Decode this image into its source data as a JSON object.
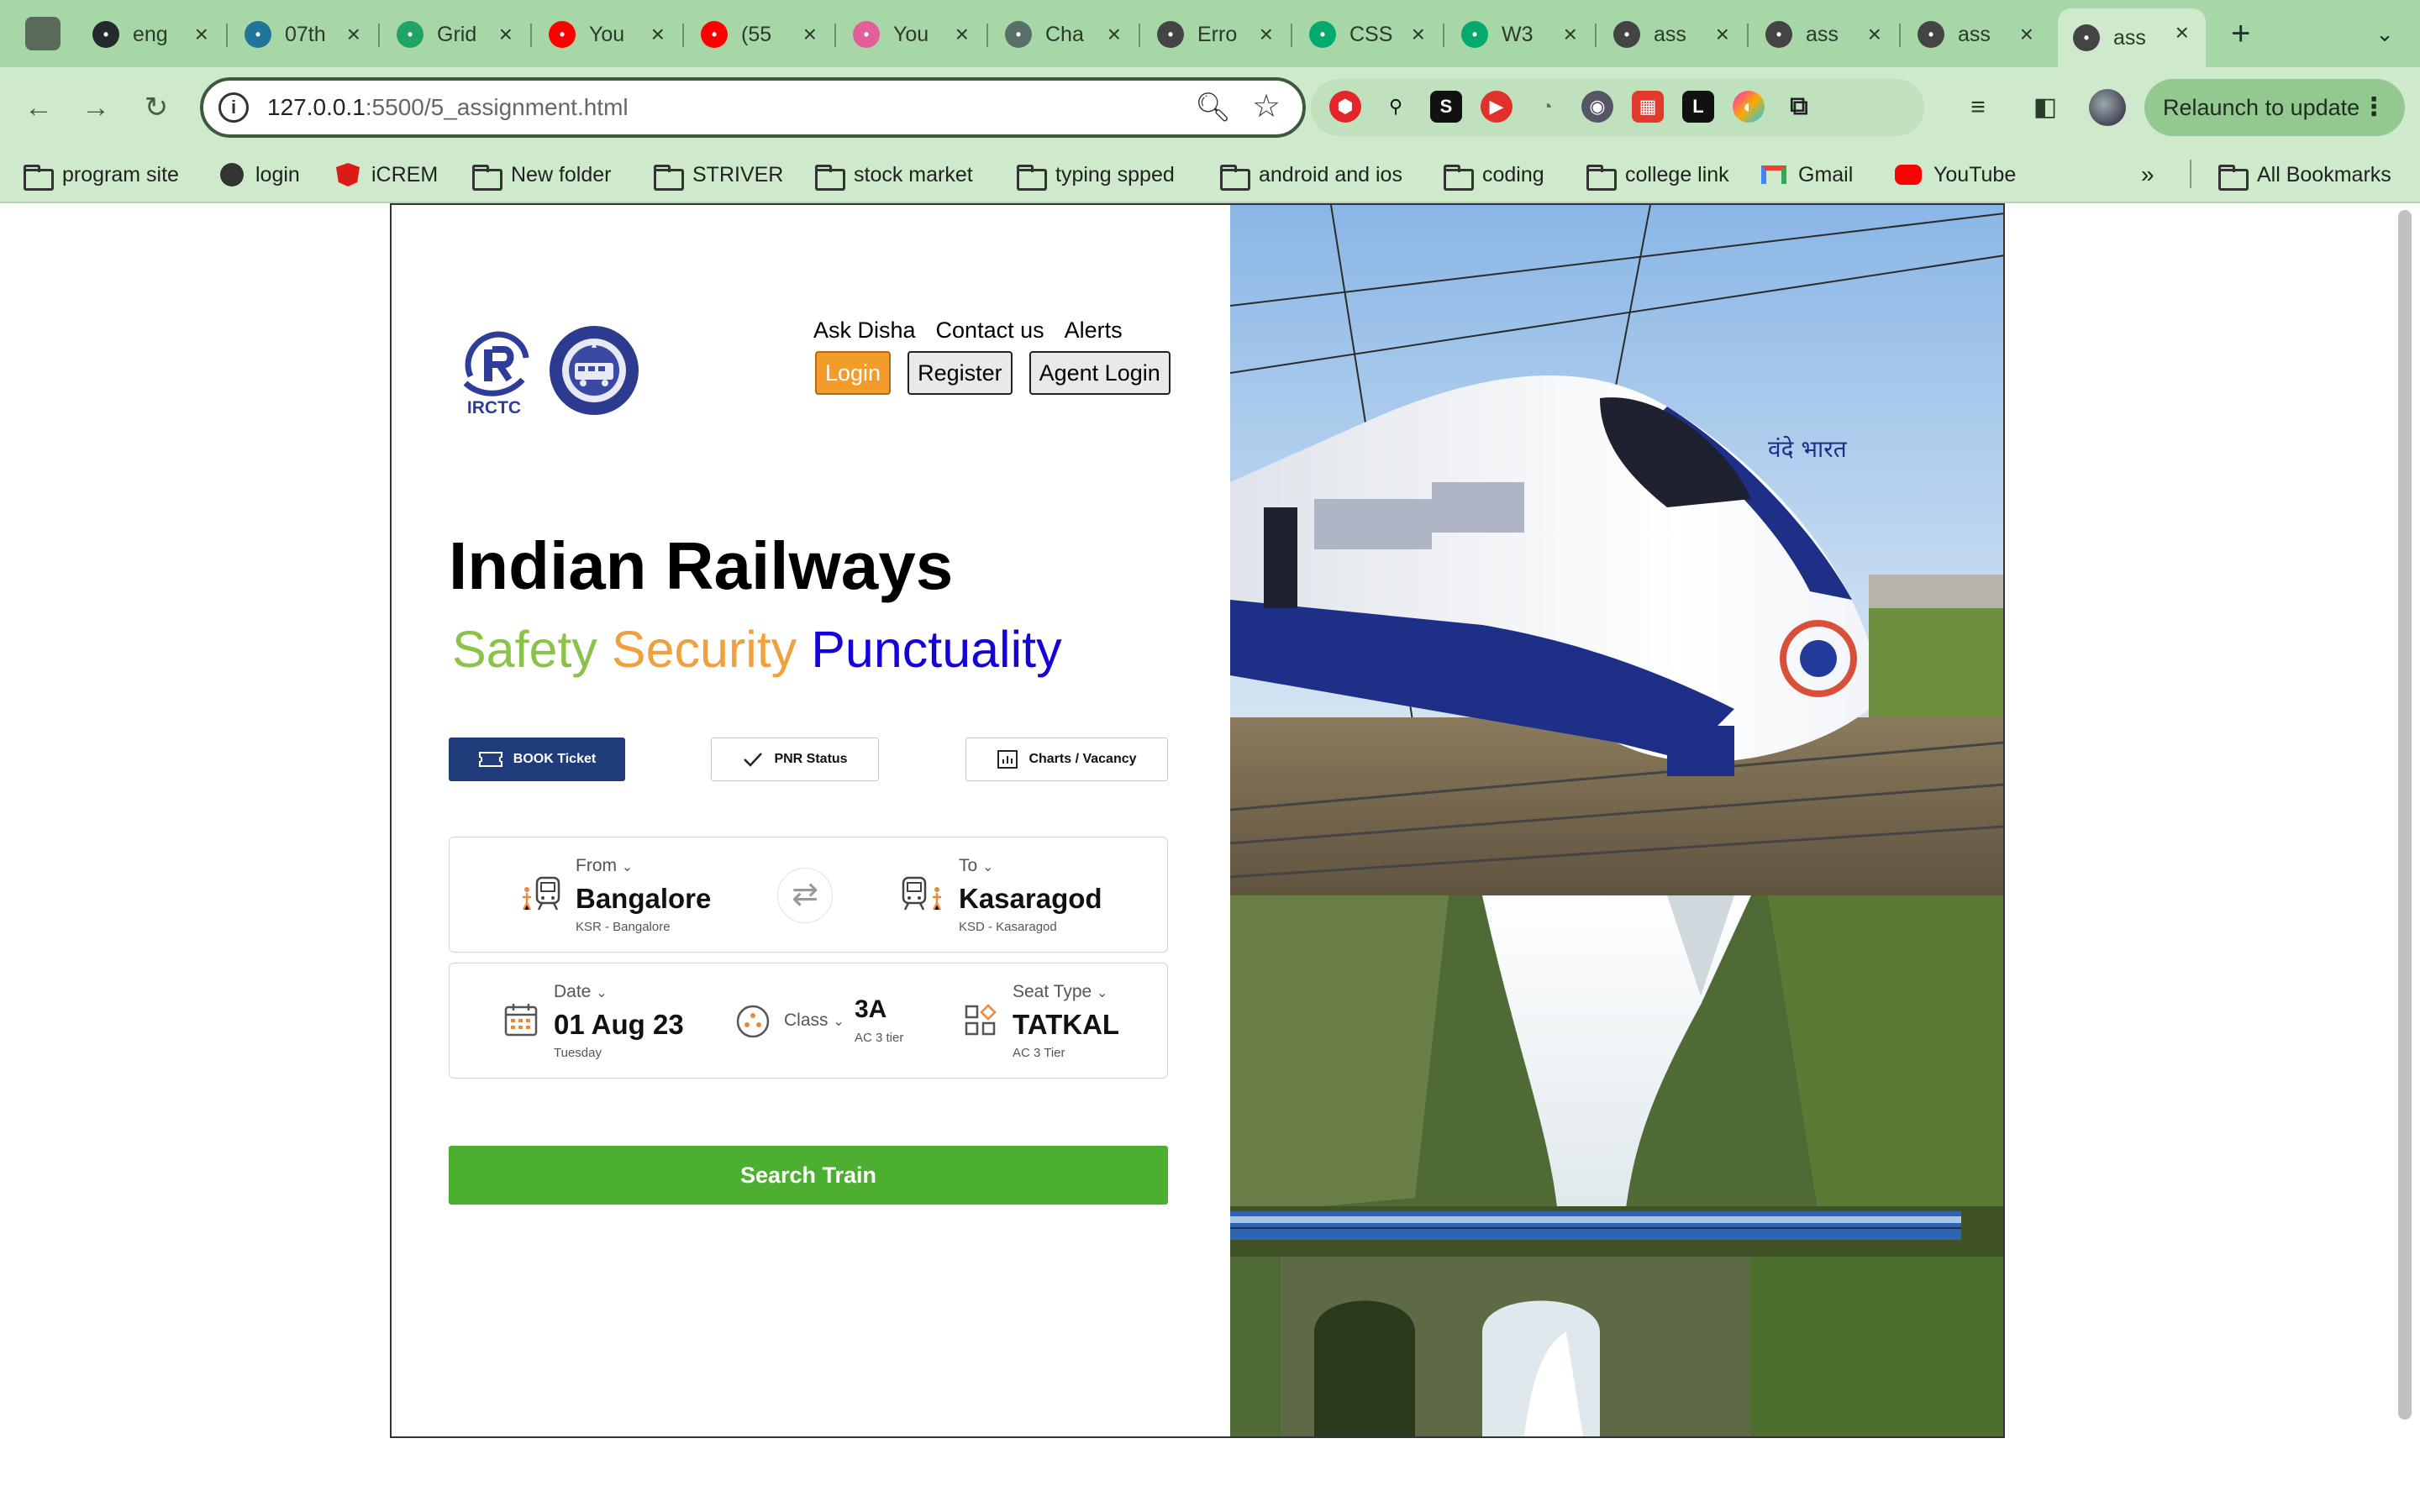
{
  "browser": {
    "tabs": [
      {
        "title": "eng",
        "icon": "github-icon",
        "color": "#24292e"
      },
      {
        "title": "07th",
        "icon": "wordpress-icon",
        "color": "#21759b"
      },
      {
        "title": "Grid",
        "icon": "drive-icon",
        "color": "#1fa463"
      },
      {
        "title": "You",
        "icon": "youtube-music-icon",
        "color": "#ff0000"
      },
      {
        "title": "(55",
        "icon": "youtube-icon",
        "color": "#ff0000"
      },
      {
        "title": "You",
        "icon": "music-note-icon",
        "color": "#e25f9a"
      },
      {
        "title": "Cha",
        "icon": "chatgpt-icon",
        "color": "#5a6e6a"
      },
      {
        "title": "Erro",
        "icon": "globe-icon",
        "color": "#444444"
      },
      {
        "title": "CSS",
        "icon": "w3schools-icon",
        "color": "#04aa6d"
      },
      {
        "title": "W3",
        "icon": "w3schools-icon",
        "color": "#04aa6d"
      },
      {
        "title": "ass",
        "icon": "globe-icon",
        "color": "#444444"
      },
      {
        "title": "ass",
        "icon": "globe-icon",
        "color": "#444444"
      },
      {
        "title": "ass",
        "icon": "globe-icon",
        "color": "#444444"
      },
      {
        "title": "ass",
        "icon": "globe-icon",
        "color": "#444444",
        "active": true
      }
    ],
    "url_host": "127.0.0.1",
    "url_rest": ":5500/5_assignment.html",
    "relaunch_label": "Relaunch to update",
    "bookmarks": [
      {
        "label": "program site",
        "icon": "folder-icon"
      },
      {
        "label": "login",
        "icon": "globe-icon"
      },
      {
        "label": "iCREM",
        "icon": "angular-icon"
      },
      {
        "label": "New folder",
        "icon": "folder-icon"
      },
      {
        "label": "STRIVER",
        "icon": "folder-icon"
      },
      {
        "label": "stock market",
        "icon": "folder-icon"
      },
      {
        "label": "typing spped",
        "icon": "folder-icon"
      },
      {
        "label": "android and ios",
        "icon": "folder-icon"
      },
      {
        "label": "coding",
        "icon": "folder-icon"
      },
      {
        "label": "college link",
        "icon": "folder-icon"
      },
      {
        "label": "Gmail",
        "icon": "gmail-icon"
      },
      {
        "label": "YouTube",
        "icon": "youtube-icon"
      }
    ],
    "all_bookmarks_label": "All Bookmarks"
  },
  "page": {
    "logo_text": "IRCTC",
    "nav": [
      "Ask Disha",
      "Contact us",
      "Alerts"
    ],
    "auth": {
      "login": "Login",
      "register": "Register",
      "agent": "Agent Login"
    },
    "title": "Indian Railways",
    "tagline": {
      "w1": "Safety",
      "w2": "Security",
      "w3": "Punctuality"
    },
    "tabs": {
      "book": "BOOK Ticket",
      "pnr": "PNR Status",
      "charts": "Charts / Vacancy"
    },
    "from": {
      "label": "From",
      "city": "Bangalore",
      "code": "KSR - Bangalore"
    },
    "to": {
      "label": "To",
      "city": "Kasaragod",
      "code": "KSD - Kasaragod"
    },
    "date": {
      "label": "Date",
      "value": "01 Aug 23",
      "day": "Tuesday"
    },
    "class": {
      "label": "Class",
      "value": "3A",
      "desc": "AC 3 tier"
    },
    "seat": {
      "label": "Seat Type",
      "value": "TATKAL",
      "desc": "AC 3 Tier"
    },
    "search_label": "Search Train",
    "train_logo_text": "वंदे भारत",
    "colors": {
      "login": "#f39c2b",
      "primary_tab": "#213c7b",
      "search": "#4caf2f",
      "safety": "#8bc34a",
      "security": "#f0a03c",
      "punctuality": "#1500d9"
    }
  }
}
